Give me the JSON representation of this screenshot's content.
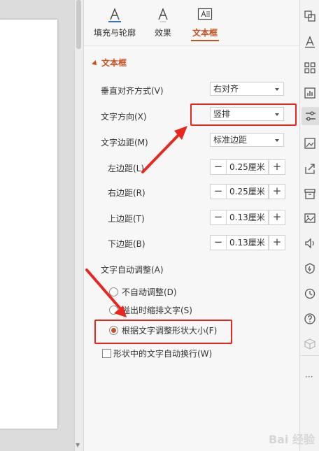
{
  "tabs": [
    {
      "label": "填充与轮廓",
      "icon": "fill-outline-icon"
    },
    {
      "label": "效果",
      "icon": "effect-icon"
    },
    {
      "label": "文本框",
      "icon": "textbox-icon"
    }
  ],
  "section": {
    "title": "文本框"
  },
  "fields": {
    "vertical_align": {
      "label": "垂直对齐方式(V)",
      "value": "右对齐"
    },
    "text_direction": {
      "label": "文字方向(X)",
      "value": "竖排"
    },
    "text_margin": {
      "label": "文字边距(M)",
      "value": "标准边距"
    },
    "left_margin": {
      "label": "左边距(L)",
      "value": "0.25厘米"
    },
    "right_margin": {
      "label": "右边距(R)",
      "value": "0.25厘米"
    },
    "top_margin": {
      "label": "上边距(T)",
      "value": "0.13厘米"
    },
    "bottom_margin": {
      "label": "下边距(B)",
      "value": "0.13厘米"
    }
  },
  "autofit": {
    "label": "文字自动调整(A)",
    "options": [
      {
        "label": "不自动调整(D)",
        "selected": false
      },
      {
        "label": "溢出时缩排文字(S)",
        "selected": false
      },
      {
        "label": "根据文字调整形状大小(F)",
        "selected": true
      }
    ],
    "wrap": {
      "label": "形状中的文字自动换行(W)",
      "checked": false
    }
  },
  "stepper": {
    "minus": "−",
    "plus": "+"
  },
  "more": "···",
  "watermark": "Bai 经验",
  "colors": {
    "accent": "#c8501e",
    "annotation": "#e8271f"
  }
}
